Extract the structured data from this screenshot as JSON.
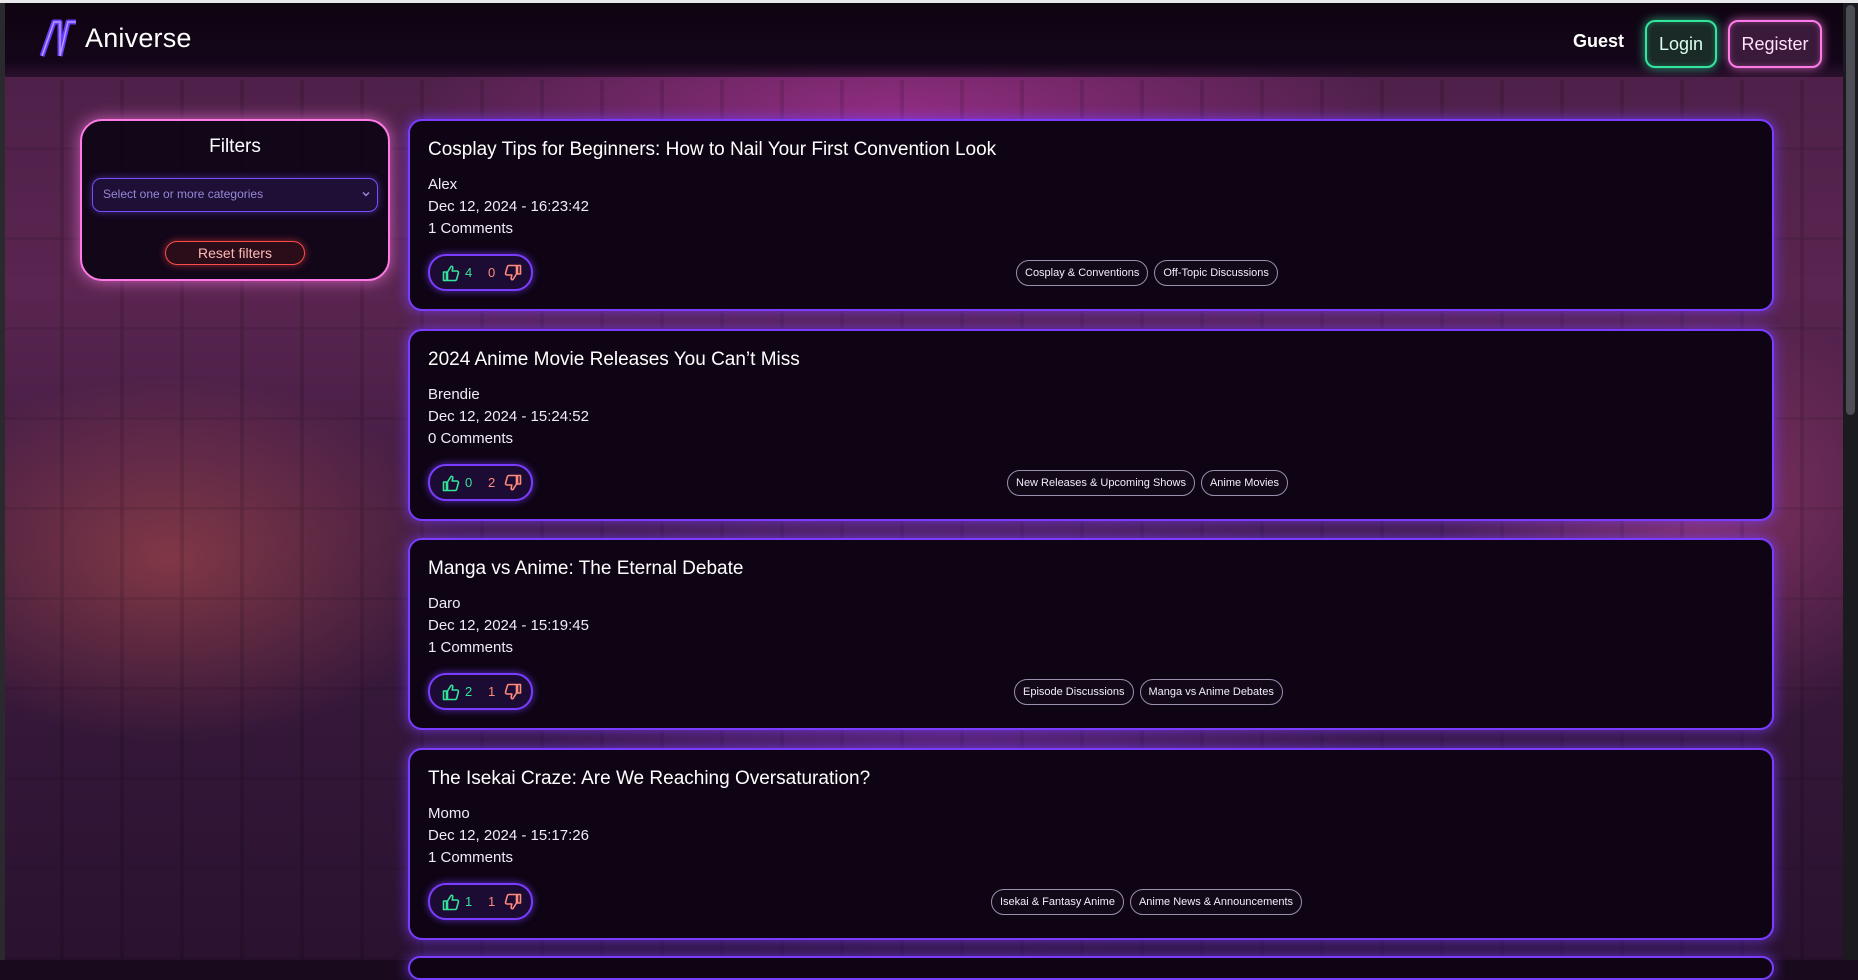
{
  "header": {
    "brand": "Aniverse",
    "guest": "Guest",
    "login": "Login",
    "register": "Register"
  },
  "filters": {
    "title": "Filters",
    "placeholder": "Select one or more categories",
    "reset": "Reset filters"
  },
  "posts": [
    {
      "title": "Cosplay Tips for Beginners: How to Nail Your First Convention Look",
      "author": "Alex",
      "date": "Dec 12, 2024 - 16:23:42",
      "comments": "1 Comments",
      "upvotes": "4",
      "downvotes": "0",
      "tags": [
        "Cosplay & Conventions",
        "Off-Topic Discussions"
      ]
    },
    {
      "title": "2024 Anime Movie Releases You Can’t Miss",
      "author": "Brendie",
      "date": "Dec 12, 2024 - 15:24:52",
      "comments": "0 Comments",
      "upvotes": "0",
      "downvotes": "2",
      "tags": [
        "New Releases & Upcoming Shows",
        "Anime Movies"
      ]
    },
    {
      "title": "Manga vs Anime: The Eternal Debate",
      "author": "Daro",
      "date": "Dec 12, 2024 - 15:19:45",
      "comments": "1 Comments",
      "upvotes": "2",
      "downvotes": "1",
      "tags": [
        "Episode Discussions",
        "Manga vs Anime Debates"
      ]
    },
    {
      "title": "The Isekai Craze: Are We Reaching Oversaturation?",
      "author": "Momo",
      "date": "Dec 12, 2024 - 15:17:26",
      "comments": "1 Comments",
      "upvotes": "1",
      "downvotes": "1",
      "tags": [
        "Isekai & Fantasy Anime",
        "Anime News & Announcements"
      ]
    }
  ],
  "colors": {
    "accent_purple": "#7a3dff",
    "login_green": "#32e6a0",
    "register_pink": "#ff7ae6",
    "reset_red": "#ff4a4a",
    "upvote_green": "#34e39a",
    "downvote_salmon": "#ff8a7a"
  },
  "icons": {
    "logo": "aniverse-logo-icon",
    "upvote": "thumbs-up-icon",
    "downvote": "thumbs-down-icon",
    "select": "chevron-down-icon"
  }
}
